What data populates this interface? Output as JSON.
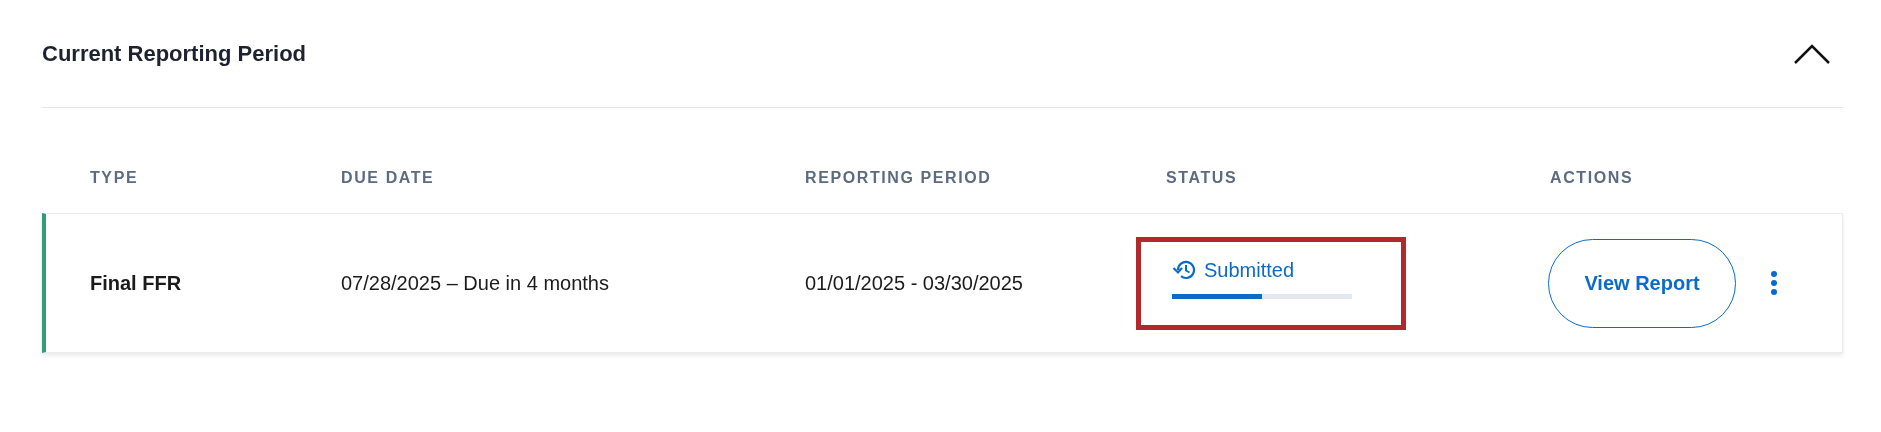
{
  "section": {
    "title": "Current Reporting Period",
    "expanded": true
  },
  "table": {
    "columns": [
      "TYPE",
      "DUE DATE",
      "REPORTING PERIOD",
      "STATUS",
      "ACTIONS"
    ],
    "rows": [
      {
        "type": "Final FFR",
        "due_date": "07/28/2025 – Due in 4 months",
        "reporting_period": "01/01/2025 - 03/30/2025",
        "status": {
          "label": "Submitted",
          "level": 0.5,
          "highlighted": true
        },
        "action": "View Report",
        "color": "#2e9f72"
      }
    ]
  }
}
